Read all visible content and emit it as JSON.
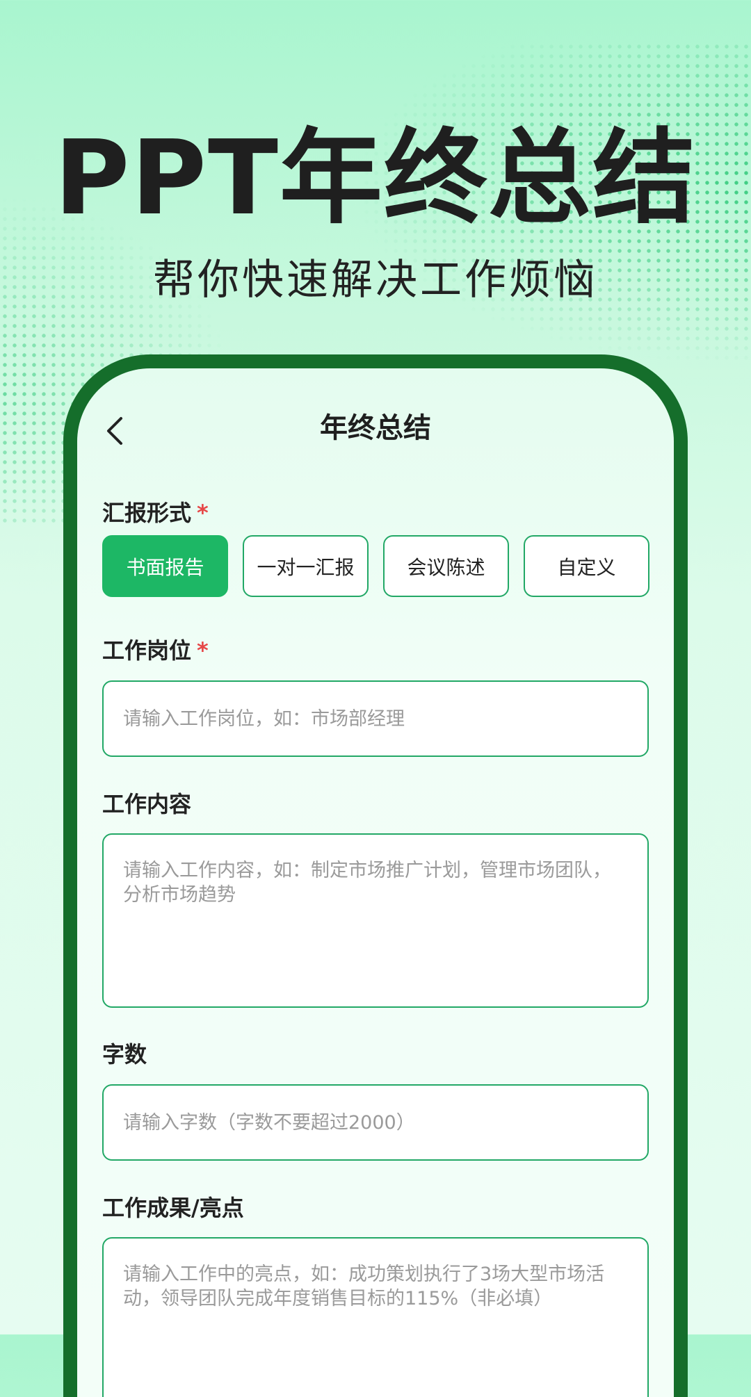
{
  "hero": {
    "title": "PPT年终总结",
    "subtitle": "帮你快速解决工作烦恼"
  },
  "nav": {
    "title": "年终总结",
    "back_icon": "chevron-left-icon"
  },
  "report_format": {
    "label": "汇报形式",
    "required_mark": "*",
    "options": [
      "书面报告",
      "一对一汇报",
      "会议陈述",
      "自定义"
    ],
    "selected": "书面报告"
  },
  "job_position": {
    "label": "工作岗位",
    "required_mark": "*",
    "placeholder": "请输入工作岗位，如：市场部经理"
  },
  "work_content": {
    "label": "工作内容",
    "placeholder": "请输入工作内容，如：制定市场推广计划，管理市场团队，分析市场趋势"
  },
  "word_count": {
    "label": "字数",
    "placeholder": "请输入字数（字数不要超过2000）"
  },
  "achievements": {
    "label": "工作成果/亮点",
    "placeholder": "请输入工作中的亮点，如：成功策划执行了3场大型市场活动，领导团队完成年度销售目标的115%（非必填）"
  },
  "colors": {
    "accent": "#1db765",
    "phone_frame": "#156e2b",
    "required": "#e64747",
    "field_border": "#22a866"
  }
}
